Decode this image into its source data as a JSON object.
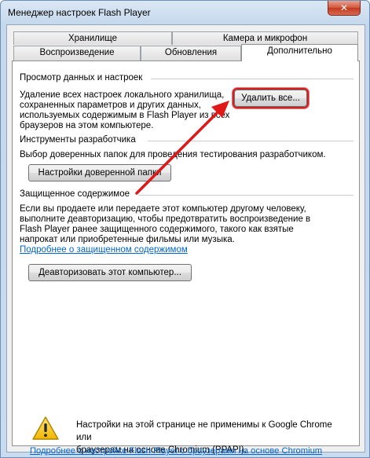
{
  "window": {
    "title": "Менеджер настроек Flash Player",
    "close_glyph": "✕"
  },
  "tabs": {
    "row1": [
      "Хранилище",
      "Камера и микрофон"
    ],
    "row2": [
      "Воспроизведение",
      "Обновления",
      "Дополнительно"
    ],
    "active": "Дополнительно"
  },
  "section1": {
    "title": "Просмотр данных и настроек",
    "lines": [
      "Удаление всех настроек локального хранилища,",
      "сохраненных параметров и других данных,",
      "используемых содержимым в Flash Player из всех",
      "браузеров на этом компьютере."
    ],
    "button": "Удалить все..."
  },
  "section2": {
    "title": "Инструменты разработчика",
    "text": "Выбор доверенных папок для проведения тестирования разработчиком.",
    "button": "Настройки доверенной папки"
  },
  "section3": {
    "title": "Защищенное содержимое",
    "lines": [
      "Если вы продаете или передаете этот компьютер другому человеку,",
      "выполните деавторизацию, чтобы предотвратить воспроизведение в",
      "Flash Player ранее защищенного содержимого, такого как взятые",
      "напрокат или приобретенные фильмы или музыка."
    ],
    "link": "Подробнее о защищенном содержимом",
    "button": "Деавторизовать этот компьютер..."
  },
  "notice": {
    "icon": "warning-icon",
    "lines": [
      "Настройки на этой странице не применимы к Google Chrome или",
      "браузерам на основе Chromium (PPAPI)."
    ],
    "link": "Подробнее о настройке Flash Player с браузерами на основе Chromium"
  },
  "colors": {
    "annotation_red": "#e01818",
    "link_blue": "#0066cc"
  }
}
